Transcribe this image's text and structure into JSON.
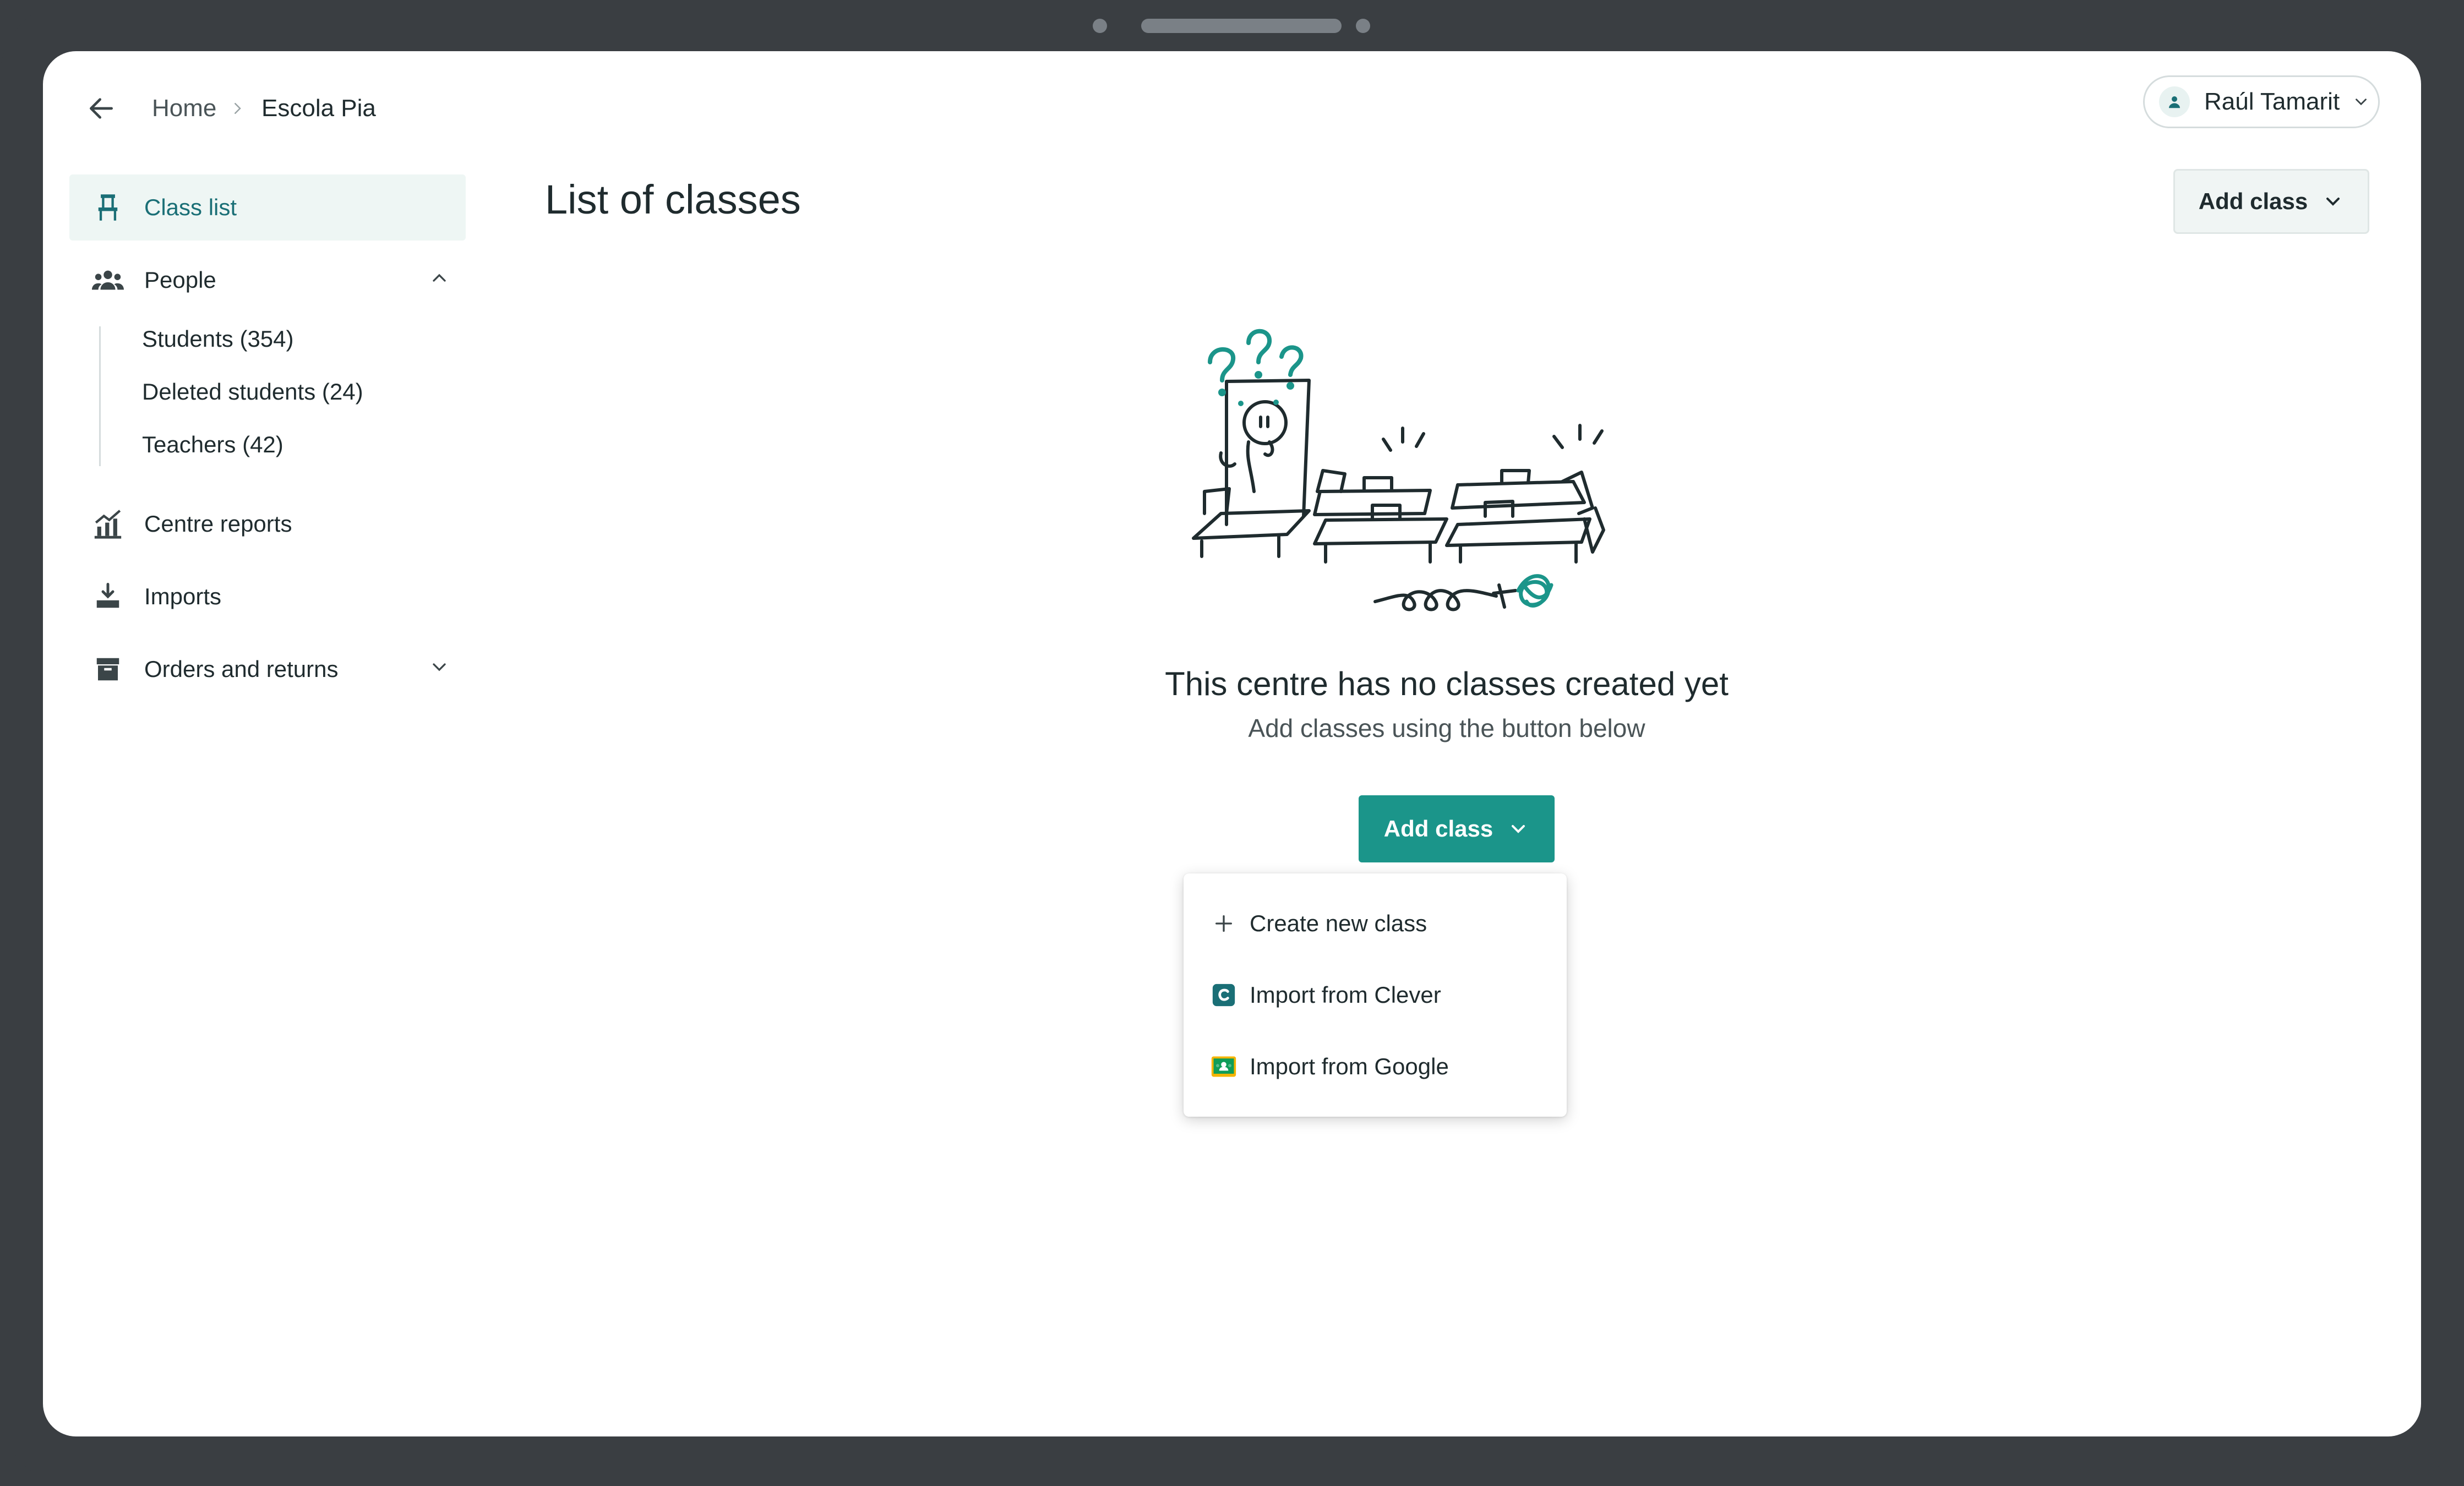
{
  "header": {
    "breadcrumb": [
      "Home",
      "Escola Pia"
    ],
    "user_name": "Raúl Tamarit"
  },
  "sidebar": {
    "items": [
      {
        "label": "Class list",
        "icon": "chair-icon",
        "active": true
      },
      {
        "label": "People",
        "icon": "people-icon",
        "expanded": true,
        "children": [
          "Students (354)",
          "Deleted students (24)",
          "Teachers (42)"
        ]
      },
      {
        "label": "Centre reports",
        "icon": "chart-icon"
      },
      {
        "label": "Imports",
        "icon": "import-icon"
      },
      {
        "label": "Orders and returns",
        "icon": "box-icon",
        "expanded": false
      }
    ]
  },
  "main": {
    "title": "List of classes",
    "top_button_label": "Add class",
    "empty_state": {
      "illustration": "confused-teacher-empty-classroom",
      "title": "This centre has no classes created yet",
      "subtitle": "Add classes using the button below",
      "button_label": "Add class"
    },
    "menu": [
      {
        "label": "Create new class",
        "icon": "plus-icon"
      },
      {
        "label": "Import from Clever",
        "icon": "clever-icon"
      },
      {
        "label": "Import from Google",
        "icon": "google-classroom-icon"
      }
    ]
  },
  "colors": {
    "accent": "#1b958a",
    "active_text": "#1a6f76",
    "active_bg": "#eef6f4",
    "device_frame": "#3a3e42"
  }
}
